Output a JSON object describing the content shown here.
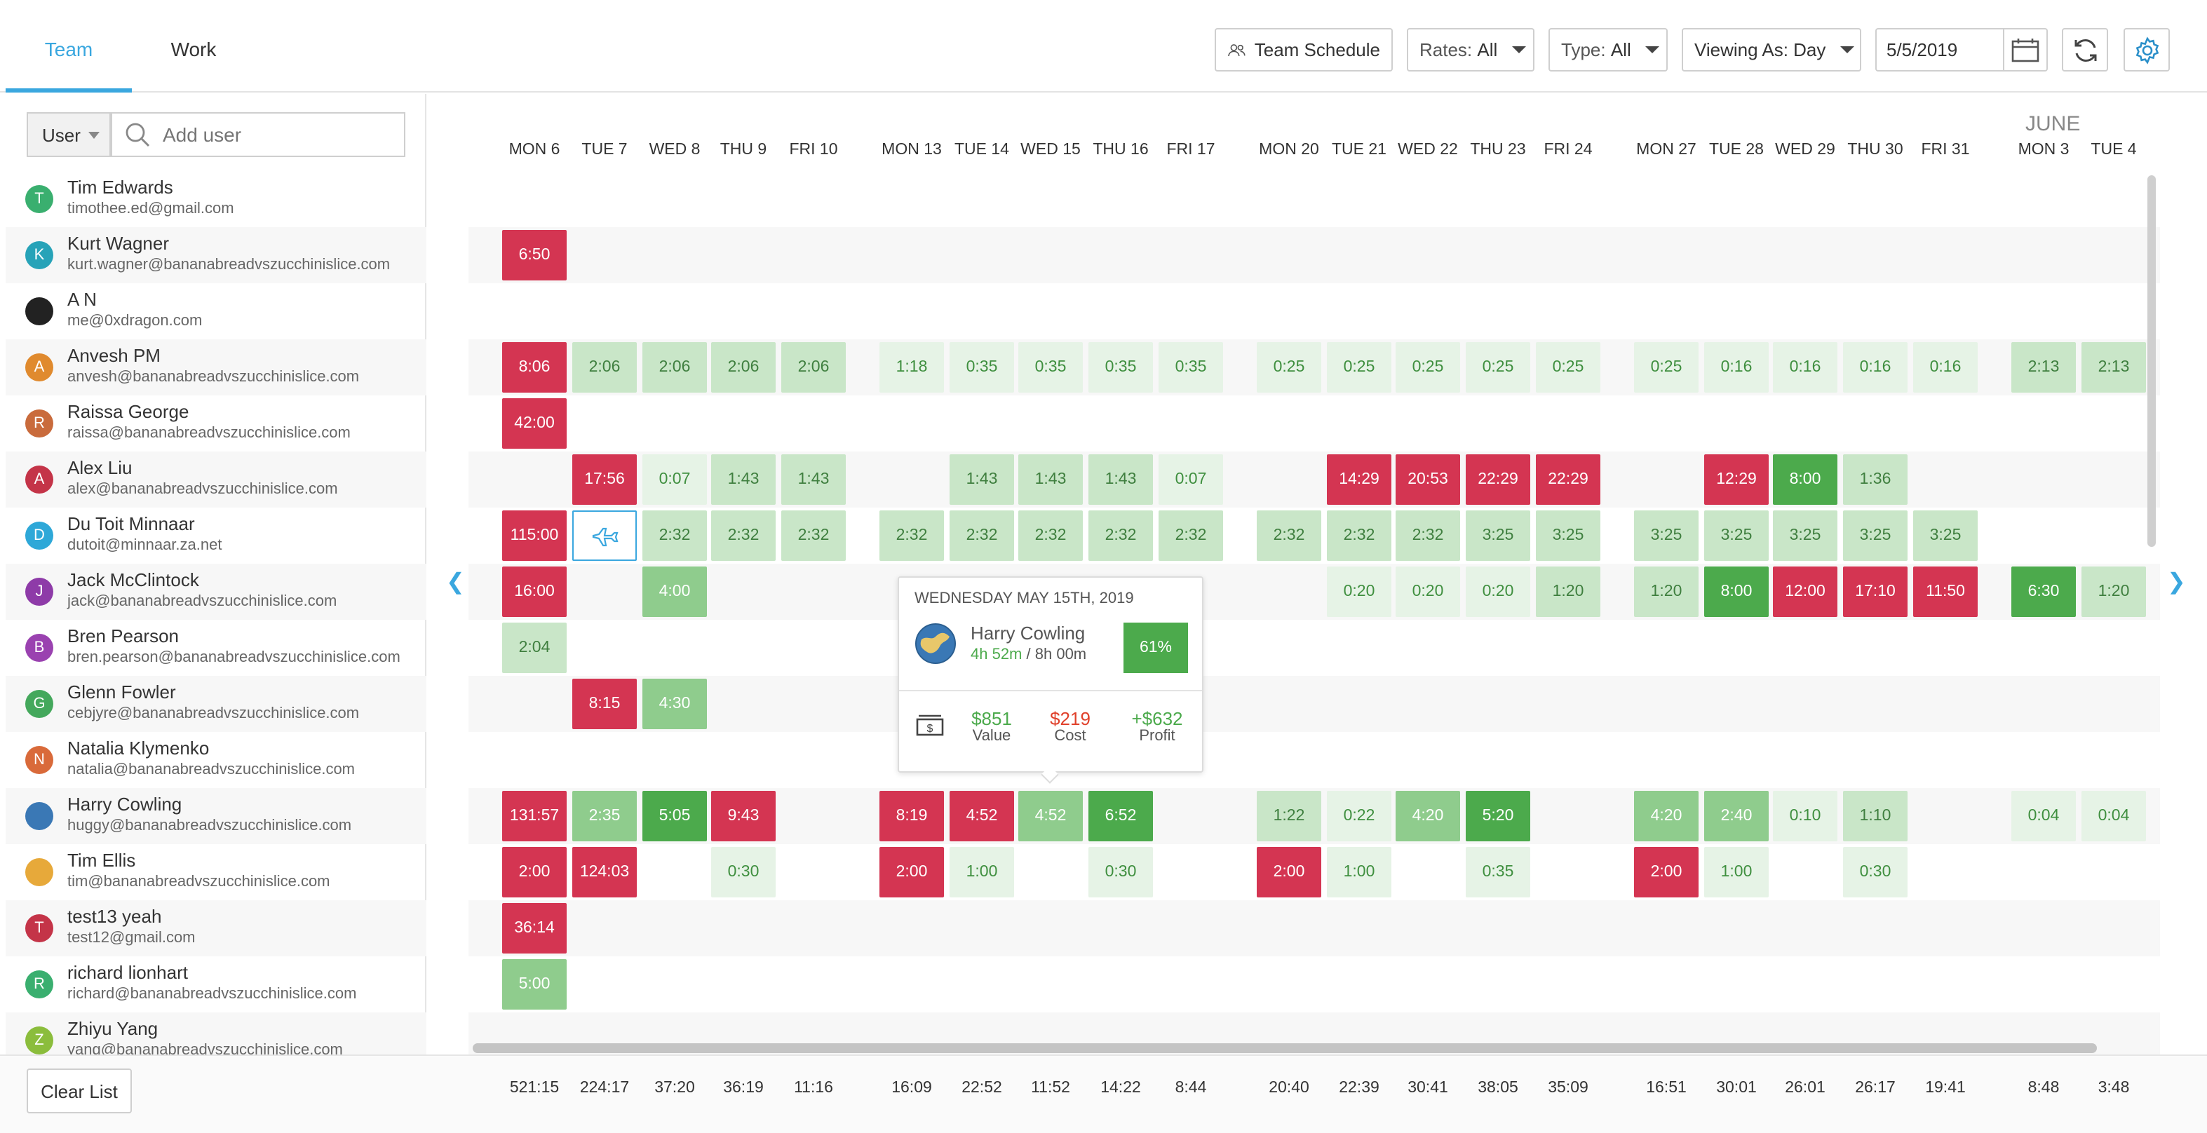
{
  "tabs": [
    {
      "label": "Team",
      "active": true
    },
    {
      "label": "Work",
      "active": false
    }
  ],
  "toolbar": {
    "team_schedule": "Team Schedule",
    "rates_label": "Rates:",
    "rates_value": "All",
    "type_label": "Type:",
    "type_value": "All",
    "viewing_as": "Viewing As: Day",
    "date_value": "5/5/2019"
  },
  "left": {
    "user_dropdown": "User",
    "add_user_placeholder": "Add user",
    "clear_list": "Clear List"
  },
  "month_label": "JUNE",
  "colors": {
    "accent": "#3aa7df",
    "over": "#d43552",
    "ok": "#4caa4c"
  },
  "users": [
    {
      "name": "Tim Edwards",
      "email": "timothee.ed@gmail.com",
      "initial": "T",
      "color": "#3aaf6f"
    },
    {
      "name": "Kurt Wagner",
      "email": "kurt.wagner@bananabreadvszucchinislice.com",
      "initial": "K",
      "color": "#27a3b8"
    },
    {
      "name": "A N",
      "email": "me@0xdragon.com",
      "initial": "",
      "color": "#222222"
    },
    {
      "name": "Anvesh PM",
      "email": "anvesh@bananabreadvszucchinislice.com",
      "initial": "A",
      "color": "#e08a2e"
    },
    {
      "name": "Raissa George",
      "email": "raissa@bananabreadvszucchinislice.com",
      "initial": "R",
      "color": "#c96b3c"
    },
    {
      "name": "Alex Liu",
      "email": "alex@bananabreadvszucchinislice.com",
      "initial": "A",
      "color": "#c43448"
    },
    {
      "name": "Du Toit Minnaar",
      "email": "dutoit@minnaar.za.net",
      "initial": "D",
      "color": "#2ea8d8"
    },
    {
      "name": "Jack McClintock",
      "email": "jack@bananabreadvszucchinislice.com",
      "initial": "J",
      "color": "#8e3ba8"
    },
    {
      "name": "Bren Pearson",
      "email": "bren.pearson@bananabreadvszucchinislice.com",
      "initial": "B",
      "color": "#9a42b0"
    },
    {
      "name": "Glenn Fowler",
      "email": "cebjyre@bananabreadvszucchinislice.com",
      "initial": "G",
      "color": "#44a85c"
    },
    {
      "name": "Natalia Klymenko",
      "email": "natalia@bananabreadvszucchinislice.com",
      "initial": "N",
      "color": "#d96a3a"
    },
    {
      "name": "Harry Cowling",
      "email": "huggy@bananabreadvszucchinislice.com",
      "initial": "",
      "color": "#3a78b5"
    },
    {
      "name": "Tim Ellis",
      "email": "tim@bananabreadvszucchinislice.com",
      "initial": "",
      "color": "#e7a93a"
    },
    {
      "name": "test13 yeah",
      "email": "test12@gmail.com",
      "initial": "T",
      "color": "#c43448"
    },
    {
      "name": "richard lionhart",
      "email": "richard@bananabreadvszucchinislice.com",
      "initial": "R",
      "color": "#3aaf6f"
    },
    {
      "name": "Zhiyu Yang",
      "email": "yang@bananabreadvszucchinislice.com",
      "initial": "Z",
      "color": "#8bbd3c"
    }
  ],
  "days": [
    "MON 6",
    "TUE 7",
    "WED 8",
    "THU 9",
    "FRI 10",
    "MON 13",
    "TUE 14",
    "WED 15",
    "THU 16",
    "FRI 17",
    "MON 20",
    "TUE 21",
    "WED 22",
    "THU 23",
    "FRI 24",
    "MON 27",
    "TUE 28",
    "WED 29",
    "THU 30",
    "FRI 31",
    "MON 3",
    "TUE 4"
  ],
  "rows": [
    [],
    [
      [
        0,
        "6:50",
        "red"
      ]
    ],
    [],
    [
      [
        0,
        "8:06",
        "red"
      ],
      [
        1,
        "2:06",
        "g2"
      ],
      [
        2,
        "2:06",
        "g2"
      ],
      [
        3,
        "2:06",
        "g2"
      ],
      [
        4,
        "2:06",
        "g2"
      ],
      [
        5,
        "1:18",
        "g1"
      ],
      [
        6,
        "0:35",
        "g1"
      ],
      [
        7,
        "0:35",
        "g1"
      ],
      [
        8,
        "0:35",
        "g1"
      ],
      [
        9,
        "0:35",
        "g1"
      ],
      [
        10,
        "0:25",
        "g1"
      ],
      [
        11,
        "0:25",
        "g1"
      ],
      [
        12,
        "0:25",
        "g1"
      ],
      [
        13,
        "0:25",
        "g1"
      ],
      [
        14,
        "0:25",
        "g1"
      ],
      [
        15,
        "0:25",
        "g1"
      ],
      [
        16,
        "0:16",
        "g1"
      ],
      [
        17,
        "0:16",
        "g1"
      ],
      [
        18,
        "0:16",
        "g1"
      ],
      [
        19,
        "0:16",
        "g1"
      ],
      [
        20,
        "2:13",
        "g2"
      ],
      [
        21,
        "2:13",
        "g2"
      ]
    ],
    [
      [
        0,
        "42:00",
        "red"
      ]
    ],
    [
      [
        1,
        "17:56",
        "red"
      ],
      [
        2,
        "0:07",
        "g1"
      ],
      [
        3,
        "1:43",
        "g2"
      ],
      [
        4,
        "1:43",
        "g2"
      ],
      [
        6,
        "1:43",
        "g2"
      ],
      [
        7,
        "1:43",
        "g2"
      ],
      [
        8,
        "1:43",
        "g2"
      ],
      [
        9,
        "0:07",
        "g1"
      ],
      [
        11,
        "14:29",
        "red"
      ],
      [
        12,
        "20:53",
        "red"
      ],
      [
        13,
        "22:29",
        "red"
      ],
      [
        14,
        "22:29",
        "red"
      ],
      [
        16,
        "12:29",
        "red"
      ],
      [
        17,
        "8:00",
        "g4"
      ],
      [
        18,
        "1:36",
        "g2"
      ]
    ],
    [
      [
        0,
        "115:00",
        "red"
      ],
      [
        1,
        "",
        "plane"
      ],
      [
        2,
        "2:32",
        "g2"
      ],
      [
        3,
        "2:32",
        "g2"
      ],
      [
        4,
        "2:32",
        "g2"
      ],
      [
        5,
        "2:32",
        "g2"
      ],
      [
        6,
        "2:32",
        "g2"
      ],
      [
        7,
        "2:32",
        "g2"
      ],
      [
        8,
        "2:32",
        "g2"
      ],
      [
        9,
        "2:32",
        "g2"
      ],
      [
        10,
        "2:32",
        "g2"
      ],
      [
        11,
        "2:32",
        "g2"
      ],
      [
        12,
        "2:32",
        "g2"
      ],
      [
        13,
        "3:25",
        "g2"
      ],
      [
        14,
        "3:25",
        "g2"
      ],
      [
        15,
        "3:25",
        "g2"
      ],
      [
        16,
        "3:25",
        "g2"
      ],
      [
        17,
        "3:25",
        "g2"
      ],
      [
        18,
        "3:25",
        "g2"
      ],
      [
        19,
        "3:25",
        "g2"
      ]
    ],
    [
      [
        0,
        "16:00",
        "red"
      ],
      [
        2,
        "4:00",
        "g3"
      ],
      [
        11,
        "0:20",
        "g1"
      ],
      [
        12,
        "0:20",
        "g1"
      ],
      [
        13,
        "0:20",
        "g1"
      ],
      [
        14,
        "1:20",
        "g2"
      ],
      [
        15,
        "1:20",
        "g2"
      ],
      [
        16,
        "8:00",
        "g4"
      ],
      [
        17,
        "12:00",
        "red"
      ],
      [
        18,
        "17:10",
        "red"
      ],
      [
        19,
        "11:50",
        "red"
      ],
      [
        20,
        "6:30",
        "g4"
      ],
      [
        21,
        "1:20",
        "g2"
      ]
    ],
    [
      [
        0,
        "2:04",
        "g2"
      ]
    ],
    [
      [
        1,
        "8:15",
        "red"
      ],
      [
        2,
        "4:30",
        "g3"
      ]
    ],
    [],
    [
      [
        0,
        "131:57",
        "red"
      ],
      [
        1,
        "2:35",
        "g3"
      ],
      [
        2,
        "5:05",
        "g4"
      ],
      [
        3,
        "9:43",
        "red"
      ],
      [
        5,
        "8:19",
        "red"
      ],
      [
        6,
        "4:52",
        "red"
      ],
      [
        7,
        "4:52",
        "g3"
      ],
      [
        8,
        "6:52",
        "g4"
      ],
      [
        10,
        "1:22",
        "g2"
      ],
      [
        11,
        "0:22",
        "g1"
      ],
      [
        12,
        "4:20",
        "g3"
      ],
      [
        13,
        "5:20",
        "g4"
      ],
      [
        15,
        "4:20",
        "g3"
      ],
      [
        16,
        "2:40",
        "g3"
      ],
      [
        17,
        "0:10",
        "g1"
      ],
      [
        18,
        "1:10",
        "g2"
      ],
      [
        20,
        "0:04",
        "g1"
      ],
      [
        21,
        "0:04",
        "g1"
      ]
    ],
    [
      [
        0,
        "2:00",
        "red"
      ],
      [
        1,
        "124:03",
        "red"
      ],
      [
        3,
        "0:30",
        "g1"
      ],
      [
        5,
        "2:00",
        "red"
      ],
      [
        6,
        "1:00",
        "g1"
      ],
      [
        8,
        "0:30",
        "g1"
      ],
      [
        10,
        "2:00",
        "red"
      ],
      [
        11,
        "1:00",
        "g1"
      ],
      [
        13,
        "0:35",
        "g1"
      ],
      [
        15,
        "2:00",
        "red"
      ],
      [
        16,
        "1:00",
        "g1"
      ],
      [
        18,
        "0:30",
        "g1"
      ]
    ],
    [
      [
        0,
        "36:14",
        "red"
      ]
    ],
    [
      [
        0,
        "5:00",
        "g3"
      ]
    ],
    []
  ],
  "totals": [
    "521:15",
    "224:17",
    "37:20",
    "36:19",
    "11:16",
    "16:09",
    "22:52",
    "11:52",
    "14:22",
    "8:44",
    "20:40",
    "22:39",
    "30:41",
    "38:05",
    "35:09",
    "16:51",
    "30:01",
    "26:01",
    "26:17",
    "19:41",
    "8:48",
    "3:48"
  ],
  "popup": {
    "date": "WEDNESDAY MAY 15TH, 2019",
    "name": "Harry Cowling",
    "hours": "4h 52m",
    "capacity": "/ 8h 00m",
    "percent": "61%",
    "value": "$851",
    "value_label": "Value",
    "cost": "$219",
    "cost_label": "Cost",
    "profit": "+$632",
    "profit_label": "Profit"
  }
}
